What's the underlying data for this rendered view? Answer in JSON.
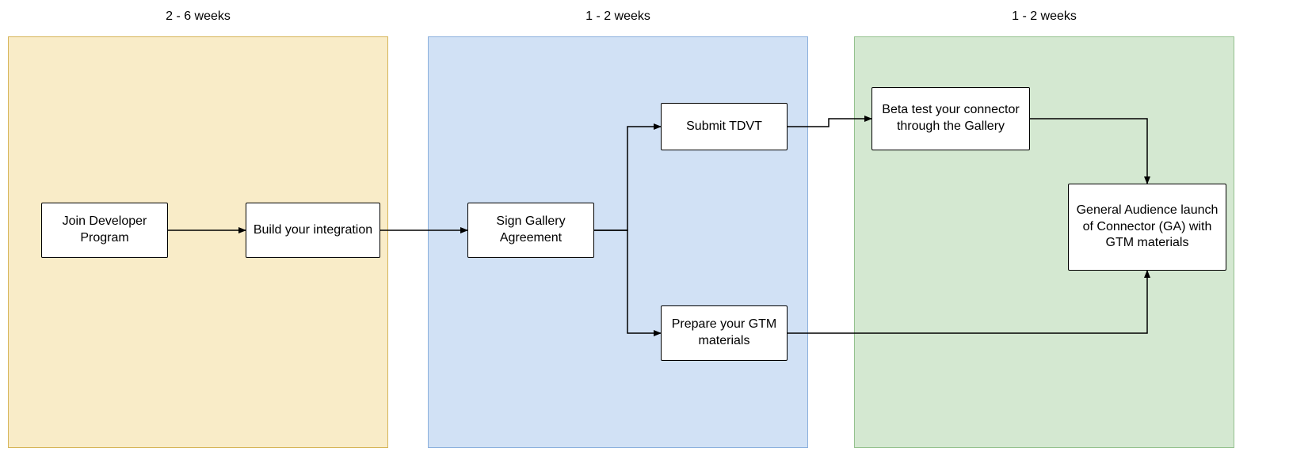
{
  "phases": [
    {
      "label": "2 - 6 weeks"
    },
    {
      "label": "1 - 2 weeks"
    },
    {
      "label": "1 - 2 weeks"
    }
  ],
  "nodes": {
    "join_dev": "Join Developer Program",
    "build_int": "Build your integration",
    "sign_gallery": "Sign Gallery Agreement",
    "submit_tdvt": "Submit TDVT",
    "prepare_gtm": "Prepare your GTM materials",
    "beta_test": "Beta test your connector through the Gallery",
    "ga_launch": "General Audience launch of Connector (GA) with GTM materials"
  },
  "colors": {
    "phase_yellow_bg": "#f9ecc8",
    "phase_yellow_border": "#d6b559",
    "phase_blue_bg": "#d1e1f5",
    "phase_blue_border": "#8cb0dd",
    "phase_green_bg": "#d4e8d1",
    "phase_green_border": "#94c18e",
    "node_bg": "#ffffff",
    "node_border": "#000000",
    "arrow": "#000000"
  }
}
